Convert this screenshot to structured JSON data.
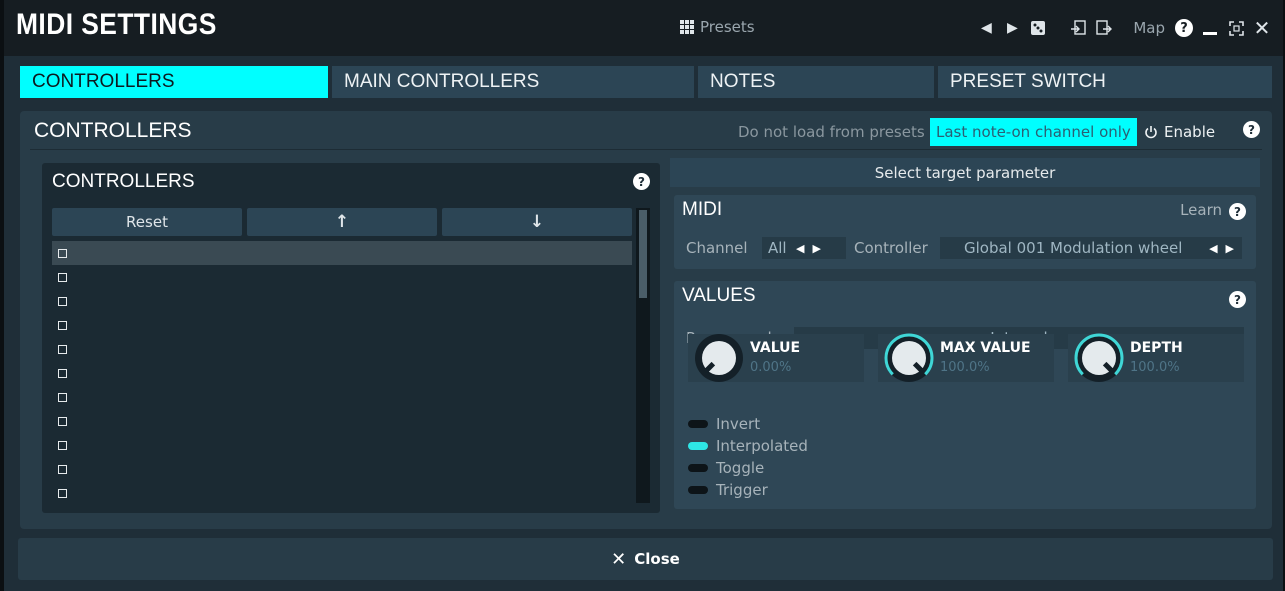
{
  "window": {
    "title": "MIDI SETTINGS",
    "presets_label": "Presets",
    "map_label": "Map"
  },
  "tabs": [
    {
      "label": "CONTROLLERS",
      "active": true
    },
    {
      "label": "MAIN CONTROLLERS",
      "active": false
    },
    {
      "label": "NOTES",
      "active": false
    },
    {
      "label": "PRESET SWITCH",
      "active": false
    }
  ],
  "panel": {
    "title": "CONTROLLERS",
    "do_not_load_label": "Do not load from presets",
    "last_note_label": "Last note-on channel only",
    "enable_label": "Enable"
  },
  "controllers_list": {
    "title": "CONTROLLERS",
    "reset_label": "Reset",
    "up_icon": "arrow-up-icon",
    "down_icon": "arrow-down-icon",
    "row_count": 11,
    "selected_row": 0
  },
  "target": {
    "label": "Select target parameter"
  },
  "midi": {
    "title": "MIDI",
    "learn_label": "Learn",
    "channel_label": "Channel",
    "channel_value": "All",
    "controller_label": "Controller",
    "controller_value": "Global 001 Modulation wheel"
  },
  "values": {
    "title": "VALUES",
    "range_mode_label": "Range mode",
    "range_mode_value": "Interval",
    "knobs": [
      {
        "name": "VALUE",
        "value": "0.00%",
        "fraction": 0.0
      },
      {
        "name": "MAX VALUE",
        "value": "100.0%",
        "fraction": 1.0
      },
      {
        "name": "DEPTH",
        "value": "100.0%",
        "fraction": 1.0
      }
    ],
    "toggles": [
      {
        "label": "Invert",
        "on": false
      },
      {
        "label": "Interpolated",
        "on": true
      },
      {
        "label": "Toggle",
        "on": false
      },
      {
        "label": "Trigger",
        "on": false
      }
    ]
  },
  "footer": {
    "close_label": "Close"
  },
  "colors": {
    "accent": "#00ffff",
    "knob_arc": "#3fd6d6",
    "toggle_on": "#2ee6e6"
  }
}
